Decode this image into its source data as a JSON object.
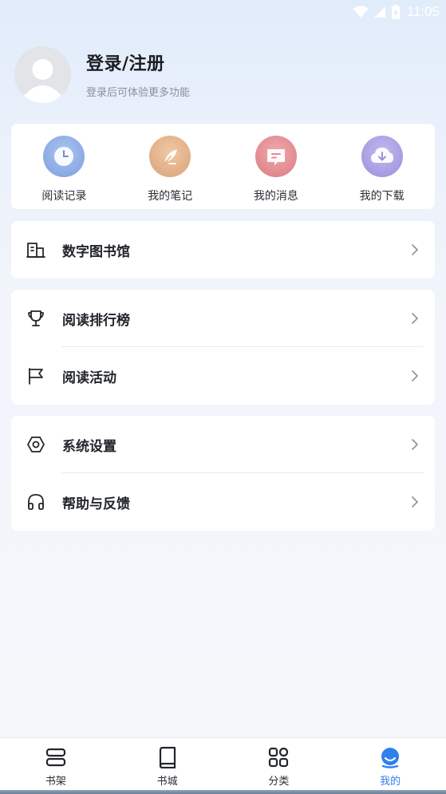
{
  "status_bar": {
    "time": "11:05"
  },
  "profile": {
    "title": "登录/注册",
    "subtitle": "登录后可体验更多功能"
  },
  "quick_actions": [
    {
      "label": "阅读记录",
      "icon": "clock-icon"
    },
    {
      "label": "我的笔记",
      "icon": "feather-icon"
    },
    {
      "label": "我的消息",
      "icon": "message-icon"
    },
    {
      "label": "我的下载",
      "icon": "cloud-download-icon"
    }
  ],
  "menu": {
    "library": "数字图书馆",
    "ranking": "阅读排行榜",
    "activity": "阅读活动",
    "settings": "系统设置",
    "help": "帮助与反馈"
  },
  "tabs": [
    {
      "label": "书架",
      "icon": "bookshelf-icon"
    },
    {
      "label": "书城",
      "icon": "book-icon"
    },
    {
      "label": "分类",
      "icon": "category-grid-icon"
    },
    {
      "label": "我的",
      "icon": "profile-icon",
      "active": true
    }
  ],
  "colors": {
    "accent": "#2f80ed",
    "text": "#22252b",
    "subtext": "#8a8f99"
  }
}
